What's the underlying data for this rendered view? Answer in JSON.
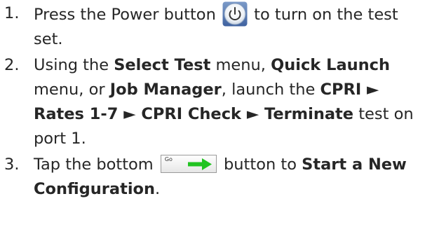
{
  "steps": [
    {
      "number": "1.",
      "before_icon": "Press the Power button",
      "icon": "power-button-icon",
      "after_icon": "to turn on the test set."
    },
    {
      "number": "2.",
      "t1": "Using the ",
      "b1": "Select Test",
      "t2": " menu, ",
      "b2": "Quick Launch",
      "t3": " menu, or ",
      "b3": "Job Manager",
      "t4": ", launch the ",
      "b4": "CPRI ► Rates 1-7 ► CPRI Check ► Terminate",
      "t5": " test on port 1."
    },
    {
      "number": "3.",
      "t1": "Tap the bottom",
      "go_button_label": "Go",
      "go_arrow_color": "#22c322",
      "t2": "button to ",
      "b1": "Start a New Configuration",
      "t3": "."
    }
  ],
  "colors": {
    "text": "#262626",
    "power_icon_ring": "#9fb1c8",
    "power_icon_fill": "#5c7fb6"
  }
}
